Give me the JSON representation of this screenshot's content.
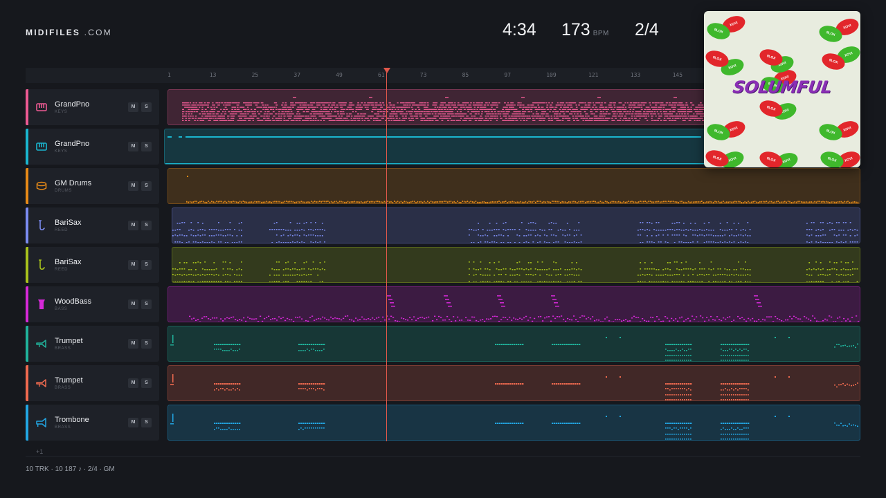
{
  "brand": {
    "name_bold": "MIDIFILES",
    "name_suffix": " .COM"
  },
  "transport": {
    "time": "4:34",
    "bpm_value": "173",
    "bpm_unit": "BPM",
    "signature": "2/4"
  },
  "ruler": {
    "ticks": [
      "1",
      "13",
      "25",
      "37",
      "49",
      "61",
      "73",
      "85",
      "97",
      "109",
      "121",
      "133",
      "145"
    ]
  },
  "tracks": [
    {
      "name": "GrandPno",
      "category": "KEYS",
      "color": "#ec5a92",
      "icon": "piano-icon",
      "mute": "M",
      "solo": "S"
    },
    {
      "name": "GrandPno",
      "category": "KEYS",
      "color": "#1ab6cf",
      "icon": "piano-icon",
      "mute": "M",
      "solo": "S"
    },
    {
      "name": "GM Drums",
      "category": "DRUMS",
      "color": "#e78a17",
      "icon": "drum-icon",
      "mute": "M",
      "solo": "S"
    },
    {
      "name": "BariSax",
      "category": "REED",
      "color": "#7b8bef",
      "icon": "saxophone-icon",
      "mute": "M",
      "solo": "S"
    },
    {
      "name": "BariSax",
      "category": "REED",
      "color": "#a8c21c",
      "icon": "saxophone-icon",
      "mute": "M",
      "solo": "S"
    },
    {
      "name": "WoodBass",
      "category": "BASS",
      "color": "#d629d8",
      "icon": "bass-icon",
      "mute": "M",
      "solo": "S"
    },
    {
      "name": "Trumpet",
      "category": "BRASS",
      "color": "#20b29b",
      "icon": "trumpet-icon",
      "mute": "M",
      "solo": "S"
    },
    {
      "name": "Trumpet",
      "category": "BRASS",
      "color": "#ef6a4f",
      "icon": "trumpet-icon",
      "mute": "M",
      "solo": "S"
    },
    {
      "name": "Trombone",
      "category": "BRASS",
      "color": "#22a6e3",
      "icon": "trombone-icon",
      "mute": "M",
      "solo": "S"
    }
  ],
  "more_tracks": "+1",
  "footer": {
    "text": "10 TRK  ·  10 187 ♪  ·  2/4  ·  GM"
  },
  "cover": {
    "title": "SOLUMFUL",
    "blob_text_a": "XOVI",
    "blob_text_b": "9LOX"
  },
  "colors": {
    "background": "#16181d",
    "playhead": "#e0574a"
  }
}
